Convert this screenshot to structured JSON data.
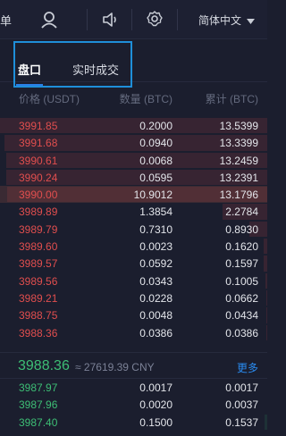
{
  "topbar": {
    "menu_fragment": "单",
    "language": "简体中文",
    "icons": [
      "user-icon",
      "sound-icon",
      "gear-icon",
      "caret-down-icon"
    ]
  },
  "tabs": [
    {
      "label": "盘口",
      "active": true
    },
    {
      "label": "实时成交",
      "active": false
    }
  ],
  "columns": {
    "price": "价格 (USDT)",
    "amount": "数量 (BTC)",
    "total": "累计 (BTC)"
  },
  "asks": [
    {
      "price": "3991.85",
      "amount": "0.2000",
      "total": "13.5399"
    },
    {
      "price": "3991.68",
      "amount": "0.0940",
      "total": "13.3399"
    },
    {
      "price": "3990.61",
      "amount": "0.0068",
      "total": "13.2459"
    },
    {
      "price": "3990.24",
      "amount": "0.0595",
      "total": "13.2391"
    },
    {
      "price": "3990.00",
      "amount": "10.9012",
      "total": "13.1796"
    },
    {
      "price": "3989.89",
      "amount": "1.3854",
      "total": "2.2784"
    },
    {
      "price": "3989.79",
      "amount": "0.7310",
      "total": "0.8930"
    },
    {
      "price": "3989.60",
      "amount": "0.0023",
      "total": "0.1620"
    },
    {
      "price": "3989.57",
      "amount": "0.0592",
      "total": "0.1597"
    },
    {
      "price": "3989.56",
      "amount": "0.0343",
      "total": "0.1005"
    },
    {
      "price": "3989.21",
      "amount": "0.0228",
      "total": "0.0662"
    },
    {
      "price": "3988.75",
      "amount": "0.0048",
      "total": "0.0434"
    },
    {
      "price": "3988.36",
      "amount": "0.0386",
      "total": "0.0386"
    }
  ],
  "mid": {
    "last_price": "3988.36",
    "approx_cny": "≈ 27619.39 CNY",
    "more_label": "更多"
  },
  "bids": [
    {
      "price": "3987.97",
      "amount": "0.0017",
      "total": "0.0017"
    },
    {
      "price": "3987.96",
      "amount": "0.0020",
      "total": "0.0037"
    },
    {
      "price": "3987.40",
      "amount": "0.1500",
      "total": "0.1537"
    }
  ],
  "colors": {
    "ask": "#e04e4e",
    "bid": "#3dbe75",
    "accent": "#2a8bf0",
    "background": "#1b1e2e"
  }
}
